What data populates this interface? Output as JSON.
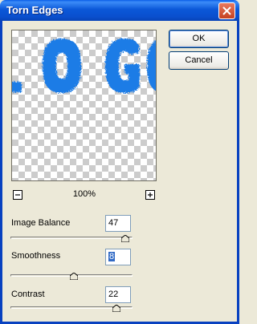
{
  "window": {
    "title": "Torn Edges"
  },
  "buttons": {
    "ok_label": "OK",
    "cancel_label": "Cancel"
  },
  "preview": {
    "zoom_level": "100%",
    "letters": "LOGO",
    "letter_color": "#1E7BE6"
  },
  "params": [
    {
      "label": "Image Balance",
      "value": "47",
      "fraction": 0.94
    },
    {
      "label": "Smoothness",
      "value": "8",
      "fraction": 0.52
    },
    {
      "label": "Contrast",
      "value": "22",
      "fraction": 0.87
    }
  ],
  "icons": {
    "close": "close-icon",
    "zoom_out": "minus-icon",
    "zoom_in": "plus-icon",
    "slider_thumb": "triangle-thumb-icon"
  }
}
